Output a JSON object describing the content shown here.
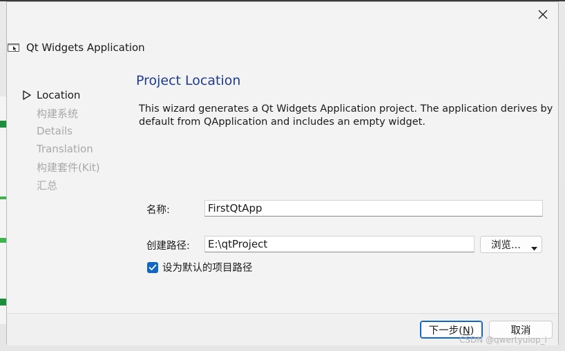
{
  "window": {
    "title": "Qt Widgets Application",
    "close_icon": "close-icon",
    "app_icon": "qt-app-icon"
  },
  "sidebar": {
    "items": [
      {
        "label": "Location",
        "active": true
      },
      {
        "label": "构建系统",
        "active": false
      },
      {
        "label": "Details",
        "active": false
      },
      {
        "label": "Translation",
        "active": false
      },
      {
        "label": "构建套件(Kit)",
        "active": false
      },
      {
        "label": "汇总",
        "active": false
      }
    ]
  },
  "page": {
    "title": "Project Location",
    "description": "This wizard generates a Qt Widgets Application project. The application derives by default from QApplication and includes an empty widget."
  },
  "form": {
    "name_label": "名称:",
    "name_value": "FirstQtApp",
    "path_label": "创建路径:",
    "path_value": "E:\\qtProject",
    "browse_label": "浏览...",
    "default_path_checkbox": {
      "label": "设为默认的项目路径",
      "checked": true
    }
  },
  "footer": {
    "next_label": "下一步(N)",
    "next_mnemonic": "N",
    "cancel_label": "取消"
  },
  "watermark": "CSDN @qwertyuiop_i",
  "colors": {
    "accent": "#1366c2",
    "title_blue": "#1f3b8f",
    "disabled_text": "#a8a8a8"
  }
}
